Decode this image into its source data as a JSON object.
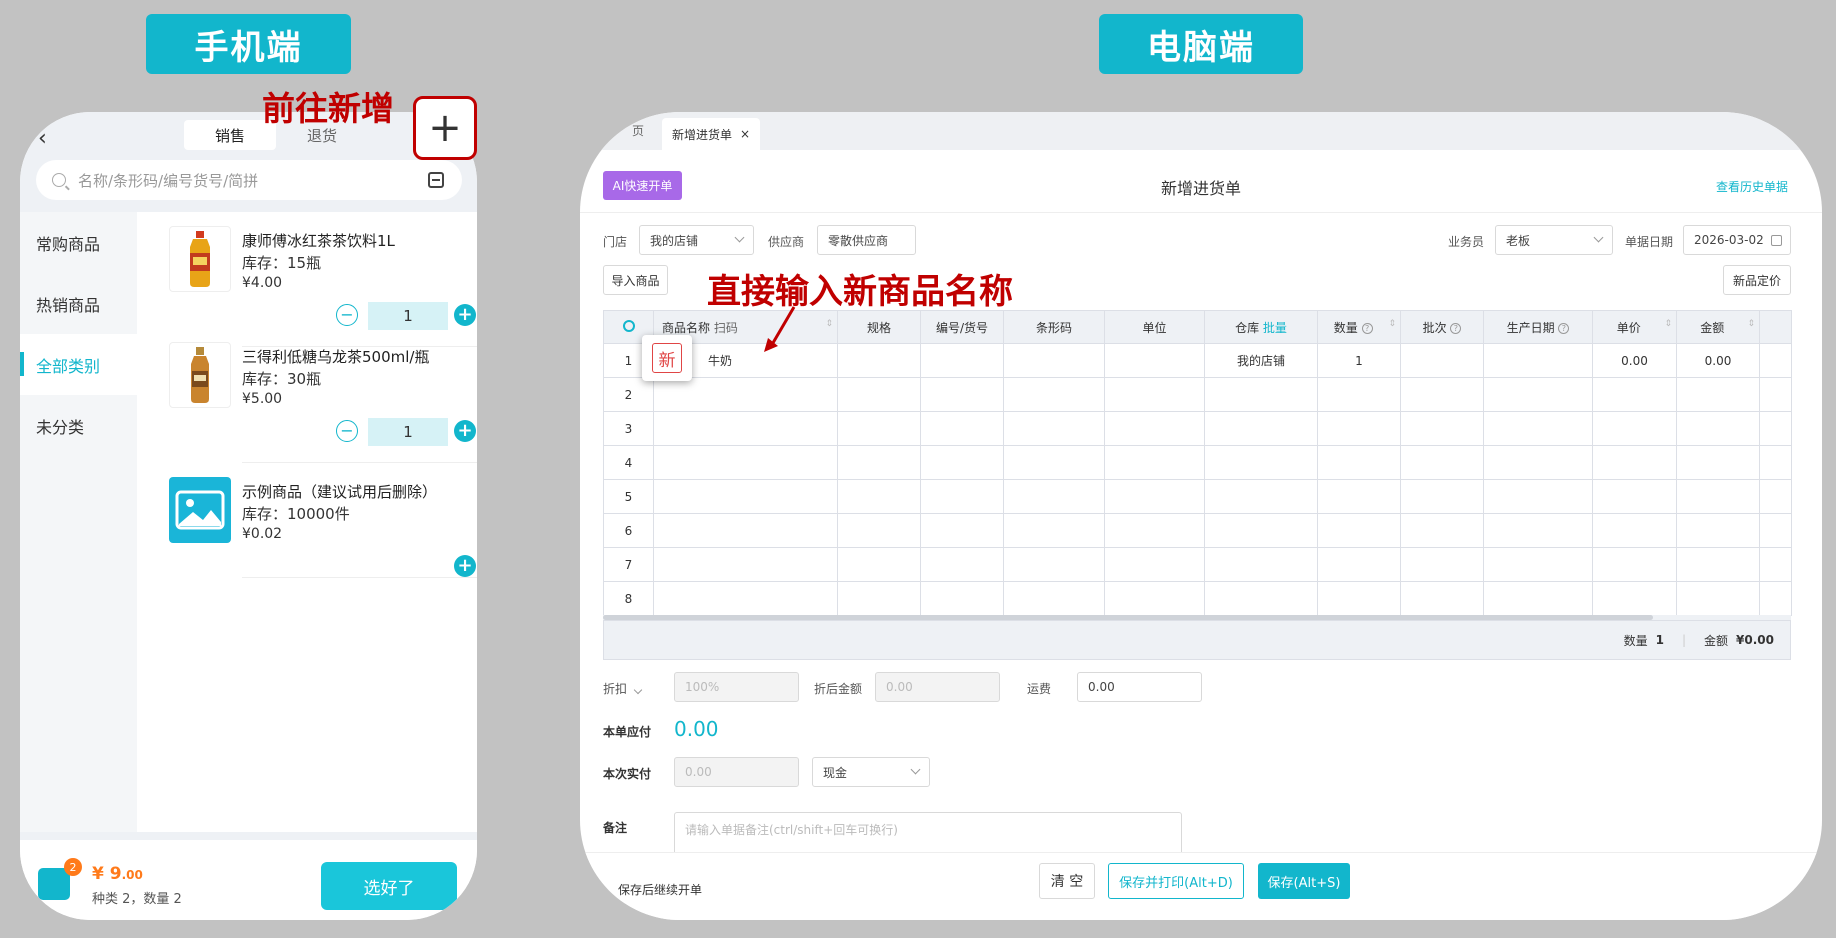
{
  "labels": {
    "mobile": "手机端",
    "pc": "电脑端",
    "go_new": "前往新增",
    "direct_input": "直接输入新商品名称"
  },
  "mobile": {
    "back_icon": "‹",
    "tabs": [
      "销售",
      "退货"
    ],
    "plus_symbol": "+",
    "search_placeholder": "名称/条形码/编号货号/简拼",
    "sidebar": [
      "常购商品",
      "热销商品",
      "全部类别",
      "未分类"
    ],
    "products": [
      {
        "name": "康师傅冰红茶茶饮料1L",
        "stock": "库存：15瓶",
        "price": "¥4.00",
        "qty": "1"
      },
      {
        "name": "三得利低糖乌龙茶500ml/瓶",
        "stock": "库存：30瓶",
        "price": "¥5.00",
        "qty": "1"
      },
      {
        "name": "示例商品（建议试用后删除）",
        "stock": "库存：10000件",
        "price": "¥0.02"
      }
    ],
    "minus_symbol": "−",
    "cart_count": "2",
    "total_prefix": "¥ ",
    "total_int": "9",
    "total_dec": ".00",
    "summary": "种类 2，数量 2",
    "done_label": "选好了"
  },
  "pc": {
    "tab_home": "页",
    "tab_active": "新增进货单",
    "tab_close": "×",
    "ai_button": "AI快速开单",
    "title": "新增进货单",
    "history_link": "查看历史单据",
    "store_label": "门店",
    "store_value": "我的店铺",
    "supplier_label": "供应商",
    "supplier_value": "零散供应商",
    "staff_label": "业务员",
    "staff_value": "老板",
    "date_label": "单据日期",
    "date_value": "2026-03-02",
    "import_button": "导入商品",
    "new_price_button": "新品定价",
    "table_headers": {
      "name": "商品名称",
      "scan": "扫码",
      "spec": "规格",
      "code": "编号/货号",
      "barcode": "条形码",
      "unit": "单位",
      "warehouse": "仓库",
      "batch_link": "批量",
      "qty": "数量",
      "batch": "批次",
      "mfg_date": "生产日期",
      "price": "单价",
      "amount": "金额"
    },
    "hint_symbol": "?",
    "sort_symbol": "⇕",
    "row_numbers": [
      "1",
      "2",
      "3",
      "4",
      "5",
      "6",
      "7",
      "8"
    ],
    "row1": {
      "name": "牛奶",
      "warehouse": "我的店铺",
      "qty": "1",
      "price": "0.00",
      "amount": "0.00"
    },
    "new_badge": "新",
    "summary_qty_label": "数量",
    "summary_qty": "1",
    "summary_sep": "|",
    "summary_amount_label": "金额",
    "summary_amount": "¥0.00",
    "discount_label": "折扣",
    "discount_value": "100%",
    "discounted_label": "折后金额",
    "discounted_value": "0.00",
    "freight_label": "运费",
    "freight_value": "0.00",
    "payable_label": "本单应付",
    "payable_value": "0.00",
    "paid_label": "本次实付",
    "paid_value": "0.00",
    "pay_method": "现金",
    "remark_label": "备注",
    "remark_placeholder": "请输入单据备注(ctrl/shift+回车可换行)",
    "continue_label": "保存后继续开单",
    "clear_button": "清 空",
    "save_print_button": "保存并打印(Alt+D)",
    "save_button": "保存(Alt+S)"
  }
}
